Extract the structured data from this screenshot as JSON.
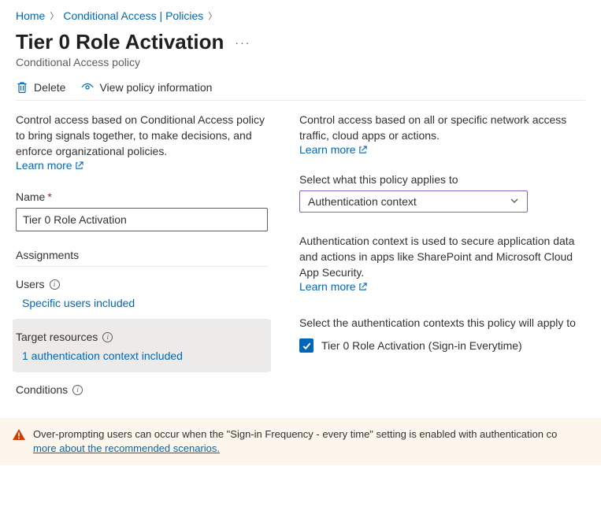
{
  "breadcrumb": {
    "home": "Home",
    "ca": "Conditional Access | Policies"
  },
  "title": "Tier 0 Role Activation",
  "subtitle": "Conditional Access policy",
  "toolbar": {
    "delete": "Delete",
    "view_info": "View policy information"
  },
  "left": {
    "intro": "Control access based on Conditional Access policy to bring signals together, to make decisions, and enforce organizational policies.",
    "learn_more": "Learn more",
    "name_label": "Name",
    "name_value": "Tier 0 Role Activation",
    "assignments_heading": "Assignments",
    "users_label": "Users",
    "users_value": "Specific users included",
    "target_label": "Target resources",
    "target_value": "1 authentication context included",
    "conditions_label": "Conditions"
  },
  "right": {
    "intro": "Control access based on all or specific network access traffic, cloud apps or actions.",
    "learn_more": "Learn more",
    "applies_label": "Select what this policy applies to",
    "applies_value": "Authentication context",
    "authctx_para": "Authentication context is used to secure application data and actions in apps like SharePoint and Microsoft Cloud App Security.",
    "select_ctx_label": "Select the authentication contexts this policy will apply to",
    "ctx_option": "Tier 0 Role Activation (Sign-in Everytime)"
  },
  "warning": {
    "text": "Over-prompting users can occur when the \"Sign-in Frequency - every time\" setting is enabled with authentication co",
    "link": "more about the recommended scenarios."
  }
}
